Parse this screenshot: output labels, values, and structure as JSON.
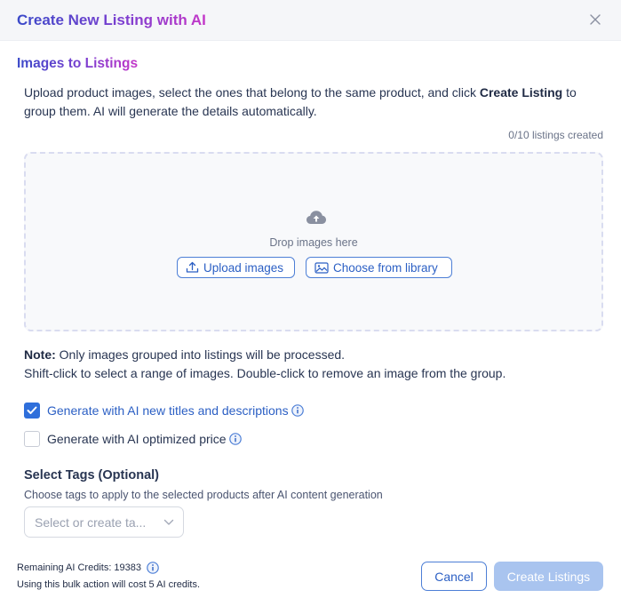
{
  "header": {
    "title": "Create New Listing with AI",
    "close_icon": "close-icon"
  },
  "section": {
    "title": "Images to Listings",
    "intro_before": "Upload product images, select the ones that belong to the same product, and click ",
    "intro_bold": "Create Listing",
    "intro_after": " to group them. AI will generate the details automatically.",
    "counter": "0/10 listings created"
  },
  "dropzone": {
    "icon": "cloud-upload-icon",
    "text": "Drop images here",
    "upload_label": "Upload images",
    "library_label": "Choose from library"
  },
  "note": {
    "label": "Note:",
    "line1": " Only images grouped into listings will be processed.",
    "line2": "Shift-click to select a range of images. Double-click to remove an image from the group."
  },
  "options": [
    {
      "label": "Generate with AI new titles and descriptions",
      "checked": true
    },
    {
      "label": "Generate with AI optimized price",
      "checked": false
    }
  ],
  "tags": {
    "title": "Select Tags (Optional)",
    "description": "Choose tags to apply to the selected products after AI content generation",
    "placeholder": "Select or create ta..."
  },
  "footer": {
    "credits": "Remaining AI Credits: 19383",
    "cost": "Using this bulk action will cost 5 AI credits.",
    "cancel_label": "Cancel",
    "create_label": "Create Listings"
  },
  "colors": {
    "accent": "#2f6fdb",
    "title_gradient_start": "#3b4ac9",
    "title_gradient_end": "#c436c8",
    "disabled_button": "#a9c4ef"
  }
}
